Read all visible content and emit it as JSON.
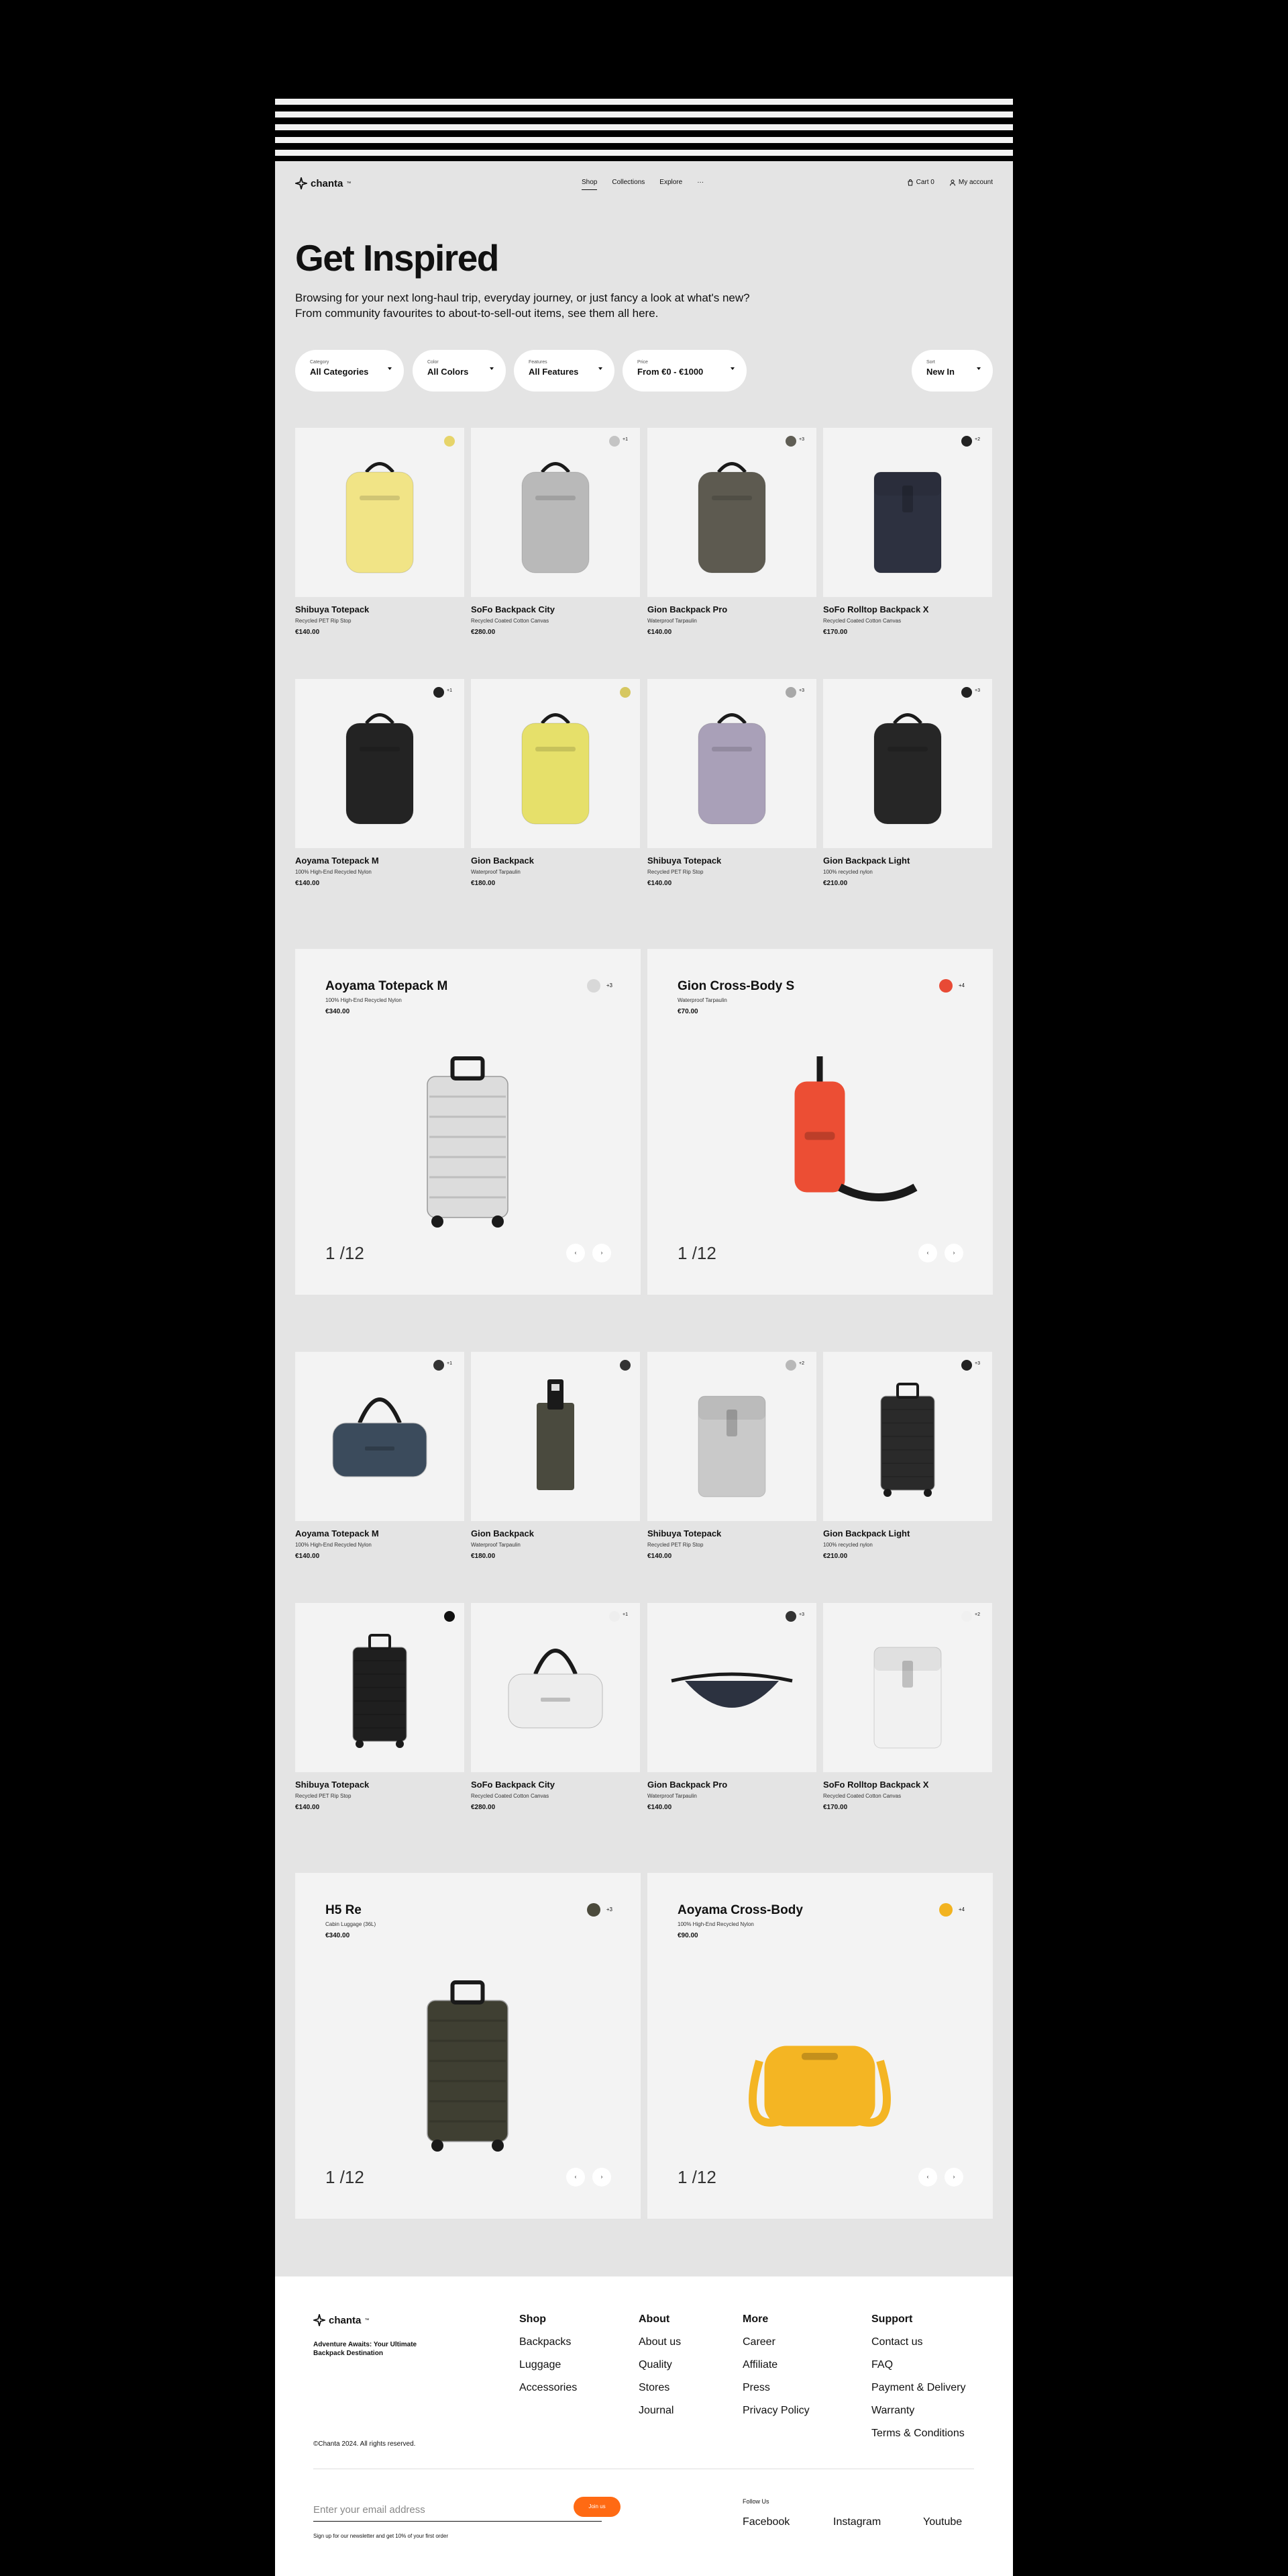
{
  "header": {
    "logo": "chanta",
    "logo_tm": "™",
    "nav": [
      "Shop",
      "Collections",
      "Explore",
      "···"
    ],
    "cart": "Cart 0",
    "account": "My account"
  },
  "intro": {
    "title": "Get Inspired",
    "text": "Browsing for your next long-haul trip, everyday journey, or just fancy a look at what's new? From community favourites to about-to-sell-out items, see them all here."
  },
  "filters": [
    {
      "label": "Category",
      "value": "All Categories"
    },
    {
      "label": "Color",
      "value": "All Colors"
    },
    {
      "label": "Features",
      "value": "All Features"
    },
    {
      "label": "Price",
      "value": "From €0 - €1000"
    },
    {
      "label": "Sort",
      "value": "New In"
    }
  ],
  "products_top": [
    {
      "name": "Shibuya Totepack",
      "material": "Recycled PET Rip Stop",
      "price": "€140.00",
      "swatch": "#e6d46a",
      "more": "",
      "icon": "totepack-yellow-image",
      "color": "#f1e486"
    },
    {
      "name": "SoFo Backpack City",
      "material": "Recycled Coated Cotton Canvas",
      "price": "€280.00",
      "swatch": "#c4c4c4",
      "more": "+1",
      "icon": "backpack-grey-image",
      "color": "#b9b9b9"
    },
    {
      "name": "Gion Backpack Pro",
      "material": "Waterproof Tarpaulin",
      "price": "€140.00",
      "swatch": "#5f5d54",
      "more": "+3",
      "icon": "backpack-olive-image",
      "color": "#5d5a50"
    },
    {
      "name": "SoFo Rolltop Backpack X",
      "material": "Recycled Coated Cotton Canvas",
      "price": "€170.00",
      "swatch": "#222222",
      "more": "+2",
      "icon": "rolltop-navy-image",
      "color": "#2d3140"
    },
    {
      "name": "Aoyama Totepack M",
      "material": "100% High-End Recycled Nylon",
      "price": "€140.00",
      "swatch": "#222222",
      "more": "+1",
      "icon": "totepack-black-image",
      "color": "#232323"
    },
    {
      "name": "Gion Backpack",
      "material": "Waterproof Tarpaulin",
      "price": "€180.00",
      "swatch": "#d6c760",
      "more": "",
      "icon": "backpack-lime-image",
      "color": "#e6e06a"
    },
    {
      "name": "Shibuya Totepack",
      "material": "Recycled PET Rip Stop",
      "price": "€140.00",
      "swatch": "#a8a8a8",
      "more": "+3",
      "icon": "totepack-lilac-image",
      "color": "#a9a0b8"
    },
    {
      "name": "Gion Backpack Light",
      "material": "100% recycled nylon",
      "price": "€210.00",
      "swatch": "#222222",
      "more": "+3",
      "icon": "backpack-black-image",
      "color": "#262626"
    }
  ],
  "features_top": [
    {
      "name": "Aoyama Totepack M",
      "material": "100% High-End Recycled Nylon",
      "price": "€340.00",
      "swatch": "#d8d8d8",
      "more": "+3",
      "count": "1 /12",
      "icon": "suitcase-white-image",
      "color": "#dcdcdc"
    },
    {
      "name": "Gion Cross-Body S",
      "material": "Waterproof Tarpaulin",
      "price": "€70.00",
      "swatch": "#e84a35",
      "more": "+4",
      "count": "1 /12",
      "icon": "crossbody-red-image",
      "color": "#ec4e34"
    }
  ],
  "products_bottom": [
    {
      "name": "Aoyama Totepack M",
      "material": "100% High-End Recycled Nylon",
      "price": "€140.00",
      "swatch": "#333333",
      "more": "+1",
      "icon": "duffel-blue-image",
      "color": "#3b4b5c"
    },
    {
      "name": "Gion Backpack",
      "material": "Waterproof Tarpaulin",
      "price": "€180.00",
      "swatch": "#333333",
      "more": "",
      "icon": "luggage-tag-olive-image",
      "color": "#4a4a3e"
    },
    {
      "name": "Shibuya Totepack",
      "material": "Recycled PET Rip Stop",
      "price": "€140.00",
      "swatch": "#b8b8b8",
      "more": "+2",
      "icon": "rolltop-silver-image",
      "color": "#c9c9c9"
    },
    {
      "name": "Gion Backpack Light",
      "material": "100% recycled nylon",
      "price": "€210.00",
      "swatch": "#222222",
      "more": "+3",
      "icon": "suitcase-black-image",
      "color": "#2a2a2a"
    },
    {
      "name": "Shibuya Totepack",
      "material": "Recycled PET Rip Stop",
      "price": "€140.00",
      "swatch": "#111111",
      "more": "",
      "icon": "cabin-suitcase-black-image",
      "color": "#1f1f1f"
    },
    {
      "name": "SoFo Backpack City",
      "material": "Recycled Coated Cotton Canvas",
      "price": "€280.00",
      "swatch": "#eeeeee",
      "more": "+1",
      "icon": "duffel-white-image",
      "color": "#ededed"
    },
    {
      "name": "Gion Backpack Pro",
      "material": "Waterproof Tarpaulin",
      "price": "€140.00",
      "swatch": "#333333",
      "more": "+3",
      "icon": "beltbag-navy-image",
      "color": "#2c3240"
    },
    {
      "name": "SoFo Rolltop Backpack X",
      "material": "Recycled Coated Cotton Canvas",
      "price": "€170.00",
      "swatch": "#f0f0f0",
      "more": "+2",
      "icon": "rolltop-white-image",
      "color": "#f1f1f1"
    }
  ],
  "features_bottom": [
    {
      "name": "H5 Re",
      "material": "Cabin Luggage (36L)",
      "price": "€340.00",
      "swatch": "#4b4a3c",
      "more": "+3",
      "count": "1 /12",
      "icon": "suitcase-olive-image",
      "color": "#3f3f32"
    },
    {
      "name": "Aoyama Cross-Body",
      "material": "100% High-End Recycled Nylon",
      "price": "€90.00",
      "swatch": "#f2b320",
      "more": "+4",
      "count": "1 /12",
      "icon": "crossbody-yellow-image",
      "color": "#f4b523"
    }
  ],
  "footer": {
    "tagline": "Adventure Awaits: Your Ultimate Backpack Destination",
    "columns": [
      {
        "title": "Shop",
        "items": [
          "Backpacks",
          "Luggage",
          "Accessories"
        ]
      },
      {
        "title": "About",
        "items": [
          "About us",
          "Quality",
          "Stores",
          "Journal"
        ]
      },
      {
        "title": "More",
        "items": [
          "Career",
          "Affiliate",
          "Press",
          "Privacy Policy"
        ]
      },
      {
        "title": "Support",
        "items": [
          "Contact us",
          "FAQ",
          "Payment & Delivery",
          "Warranty",
          "Terms & Conditions"
        ]
      }
    ],
    "copyright": "©Chanta 2024. All rights reserved.",
    "email_placeholder": "Enter your email address",
    "join": "Join us",
    "note": "Sign up for our newsletter and get 10% of your first order",
    "follow_label": "Follow Us",
    "social": [
      "Facebook",
      "Instagram",
      "Youtube"
    ]
  },
  "colors": {
    "accent": "#ff6a13",
    "background": "#e4e4e4",
    "card": "#f3f3f3"
  }
}
